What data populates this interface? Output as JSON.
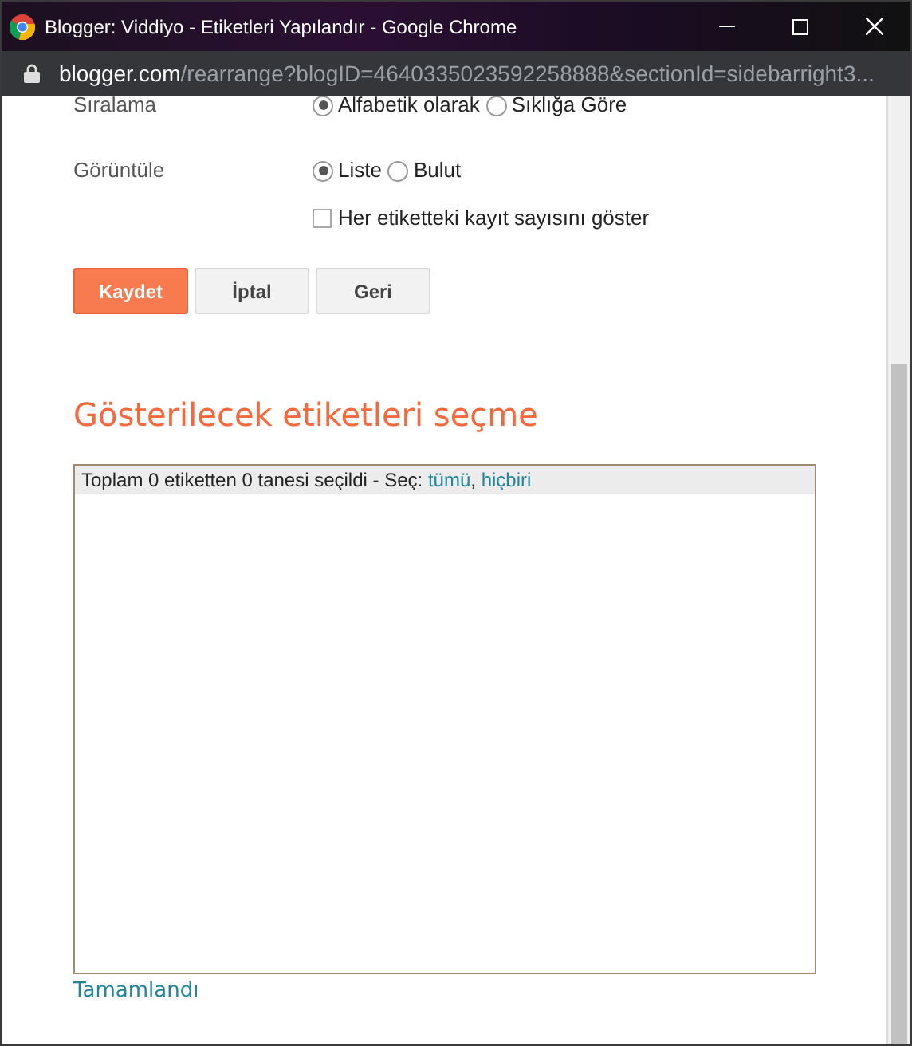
{
  "window": {
    "title": "Blogger: Viddiyo - Etiketleri Yapılandır - Google Chrome"
  },
  "address_bar": {
    "domain": "blogger.com",
    "path": "/rearrange?blogID=4640335023592258888&sectionId=sidebarright3..."
  },
  "settings": [
    {
      "label": "Sıralama",
      "kind": "radio",
      "options": [
        {
          "label": "Alfabetik olarak",
          "selected": true
        },
        {
          "label": "Sıklığa Göre",
          "selected": false
        }
      ]
    },
    {
      "label": "Görüntüle",
      "kind": "radio",
      "options": [
        {
          "label": "Liste",
          "selected": true
        },
        {
          "label": "Bulut",
          "selected": false
        }
      ]
    },
    {
      "kind": "checkbox",
      "label": "Her etiketteki kayıt sayısını göster",
      "checked": false
    }
  ],
  "buttons": [
    {
      "label": "Kaydet",
      "kind": "primary"
    },
    {
      "label": "İptal",
      "kind": "secondary"
    },
    {
      "label": "Geri",
      "kind": "secondary"
    }
  ],
  "heading": "Gösterilecek etiketleri seçme",
  "label_selector": {
    "summary": "Toplam 0 etiketten 0 tanesi seçildi - Seç:",
    "links": [
      "tümü",
      "hiçbiri"
    ],
    "separator": ","
  },
  "done_link": "Tamamlandı"
}
